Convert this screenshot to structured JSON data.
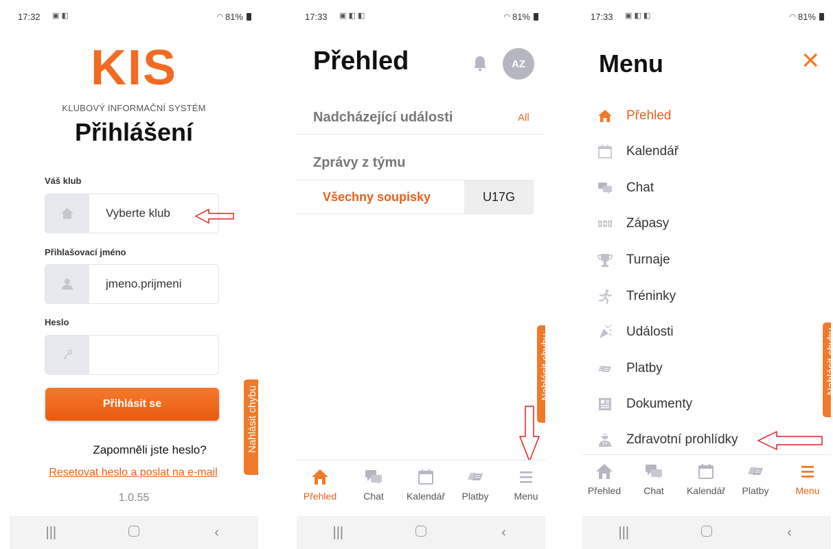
{
  "colors": {
    "accent": "#f26b22",
    "accent_text": "#e8601a",
    "icon_grey": "#b4b4c0"
  },
  "status": [
    {
      "time": "17:32",
      "battery": "81%"
    },
    {
      "time": "17:33",
      "battery": "81%"
    },
    {
      "time": "17:33",
      "battery": "81%"
    }
  ],
  "login": {
    "logo": "KIS",
    "subtitle": "KLUBOVÝ INFORMAČNÍ SYSTÉM",
    "title": "Přihlášení",
    "club_label": "Váš klub",
    "club_value": "Vyberte klub",
    "club_icon": "home-icon",
    "username_label": "Přihlašovací jméno",
    "username_value": "jmeno.prijmeni",
    "username_icon": "user-icon",
    "password_label": "Heslo",
    "password_value": "",
    "password_icon": "key-icon",
    "login_button": "Přihlásit se",
    "forgot": "Zapomněli jste heslo?",
    "reset": "Resetovat heslo a poslat na e-mail",
    "version": "1.0.55",
    "report": "Nahlásit chybu"
  },
  "overview": {
    "title": "Přehled",
    "avatar": "AZ",
    "upcoming": "Nadcházející události",
    "all": "All",
    "team_news": "Zprávy z týmu",
    "all_rosters": "Všechny soupisky",
    "team": "U17G",
    "report": "Nahlásit chybu"
  },
  "tabs": [
    {
      "label": "Přehled",
      "icon": "home-icon"
    },
    {
      "label": "Chat",
      "icon": "chat-icon"
    },
    {
      "label": "Kalendář",
      "icon": "calendar-icon"
    },
    {
      "label": "Platby",
      "icon": "payments-icon"
    },
    {
      "label": "Menu",
      "icon": "menu-icon"
    }
  ],
  "menu": {
    "title": "Menu",
    "close_icon": "close-icon",
    "report": "Nahlásit chybu",
    "items": [
      {
        "label": "Přehled",
        "icon": "home-icon",
        "active": true
      },
      {
        "label": "Kalendář",
        "icon": "calendar-icon"
      },
      {
        "label": "Chat",
        "icon": "chat-icon"
      },
      {
        "label": "Zápasy",
        "icon": "scoreboard-icon"
      },
      {
        "label": "Turnaje",
        "icon": "trophy-icon"
      },
      {
        "label": "Tréninky",
        "icon": "running-icon"
      },
      {
        "label": "Události",
        "icon": "events-icon"
      },
      {
        "label": "Platby",
        "icon": "payments-icon"
      },
      {
        "label": "Dokumenty",
        "icon": "documents-icon"
      },
      {
        "label": "Zdravotní prohlídky",
        "icon": "doctor-icon"
      }
    ]
  }
}
